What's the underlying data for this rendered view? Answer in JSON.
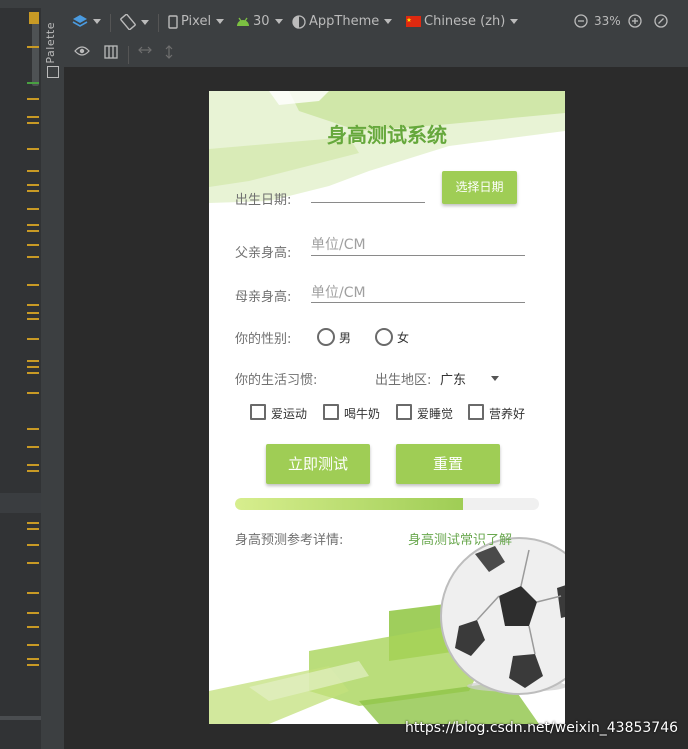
{
  "toolbar": {
    "device": "Pixel",
    "api_level": "30",
    "theme": "AppTheme",
    "locale": "Chinese (zh)",
    "zoom": "33%"
  },
  "palette": {
    "label": "Palette"
  },
  "app": {
    "title": "身高测试系统",
    "birthdate_label": "出生日期:",
    "choose_date_button": "选择日期",
    "father_label": "父亲身高:",
    "father_placeholder": "单位/CM",
    "mother_label": "母亲身高:",
    "mother_placeholder": "单位/CM",
    "gender_label": "你的性别:",
    "gender_options": [
      "男",
      "女"
    ],
    "habits_label": "你的生活习惯:",
    "region_label": "出生地区:",
    "region_value": "广东",
    "habits": [
      "爱运动",
      "喝牛奶",
      "爱睡觉",
      "营养好"
    ],
    "test_button": "立即测试",
    "reset_button": "重置",
    "progress_fraction": 0.75,
    "detail_label": "身高预测参考详情:",
    "knowledge_link": "身高测试常识了解"
  },
  "colors": {
    "accent_green": "#9fcd55",
    "title_green": "#66a83c",
    "link_green": "#6aa84f"
  },
  "watermark": "https://blog.csdn.net/weixin_43853746"
}
